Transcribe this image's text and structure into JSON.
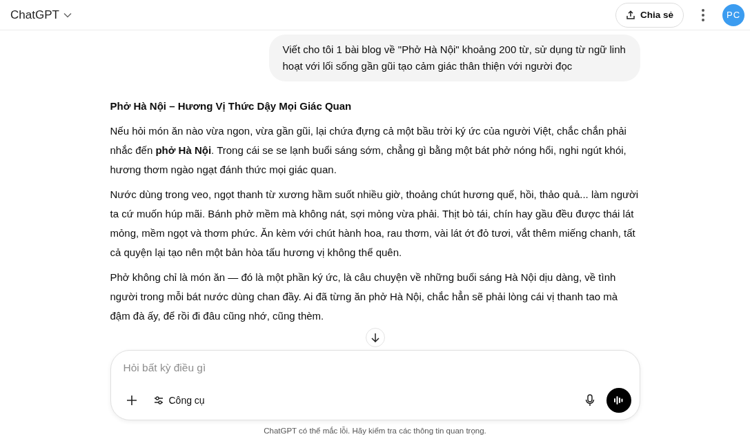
{
  "header": {
    "title": "ChatGPT",
    "share_label": "Chia sẻ",
    "avatar": "PC"
  },
  "messages": [
    {
      "kind": "user",
      "text": "Viết cho tôi 1 bài blog về \"Phở Hà Nội\" khoảng 200 từ, sử dụng từ ngữ linh hoạt với lối sống gần gũi tạo cảm giác thân thiện với người đọc"
    },
    {
      "kind": "assistant",
      "title": "Phở Hà Nội – Hương Vị Thức Dậy Mọi Giác Quan",
      "paragraphs": [
        "Nếu hỏi món ăn nào vừa ngon, vừa gần gũi, lại chứa đựng cả một bầu trời ký ức của người Việt, chắc chắn phải nhắc đến **phở Hà Nội**. Trong cái se se lạnh buổi sáng sớm, chẳng gì bằng một bát phở nóng hổi, nghi ngút khói, hương thơm ngào ngạt đánh thức mọi giác quan.",
        "Nước dùng trong veo, ngọt thanh từ xương hầm suốt nhiều giờ, thoảng chút hương quế, hồi, thảo quả... làm người ta cứ muốn húp mãi. Bánh phở mềm mà không nát, sợi mỏng vừa phải. Thịt bò tái, chín hay gầu đều được thái lát mỏng, mềm ngọt và thơm phức. Ăn kèm với chút hành hoa, rau thơm, vài lát ớt đỏ tươi, vắt thêm miếng chanh, tất cả quyện lại tạo nên một bản hòa tấu hương vị không thể quên.",
        "Phở không chỉ là món ăn — đó là một phần ký ức, là câu chuyện về những buổi sáng Hà Nội dịu dàng, về tình người trong mỗi bát nước dùng chan đầy. Ai đã từng ăn phở Hà Nội, chắc hẳn sẽ phải lòng cái vị thanh tao mà đậm đà ấy, để rồi đi đâu cũng nhớ, cũng thèm."
      ]
    }
  ],
  "composer": {
    "placeholder": "Hỏi bất kỳ điều gì",
    "tools_label": "Công cụ"
  },
  "footer": "ChatGPT có thể mắc lỗi. Hãy kiểm tra các thông tin quan trọng."
}
